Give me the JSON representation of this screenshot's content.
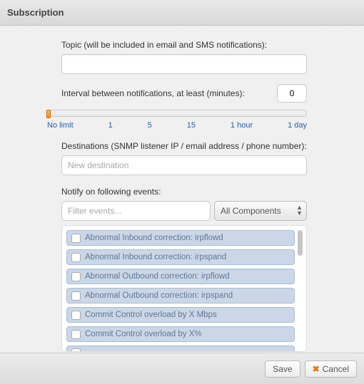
{
  "title": "Subscription",
  "topic": {
    "label": "Topic (will be included in email and SMS notifications):",
    "value": ""
  },
  "interval": {
    "label": "Interval between notifications, at least (minutes):",
    "value": "0",
    "ticks": [
      "No limit",
      "1",
      "5",
      "15",
      "1 hour",
      "1 day"
    ]
  },
  "destinations": {
    "label": "Destinations (SNMP listener IP / email address / phone number):",
    "placeholder": "New destination"
  },
  "events": {
    "label": "Notify on following events:",
    "filter_placeholder": "Filter events...",
    "component_select": "All Components",
    "items": [
      "Abnormal Inbound correction: irpflowd",
      "Abnormal Inbound correction: irpspand",
      "Abnormal Outbound correction: irpflowd",
      "Abnormal Outbound correction: irpspand",
      "Commit Control overload by X Mbps",
      "Commit Control overload by X%"
    ]
  },
  "footer": {
    "save": "Save",
    "cancel": "Cancel"
  }
}
